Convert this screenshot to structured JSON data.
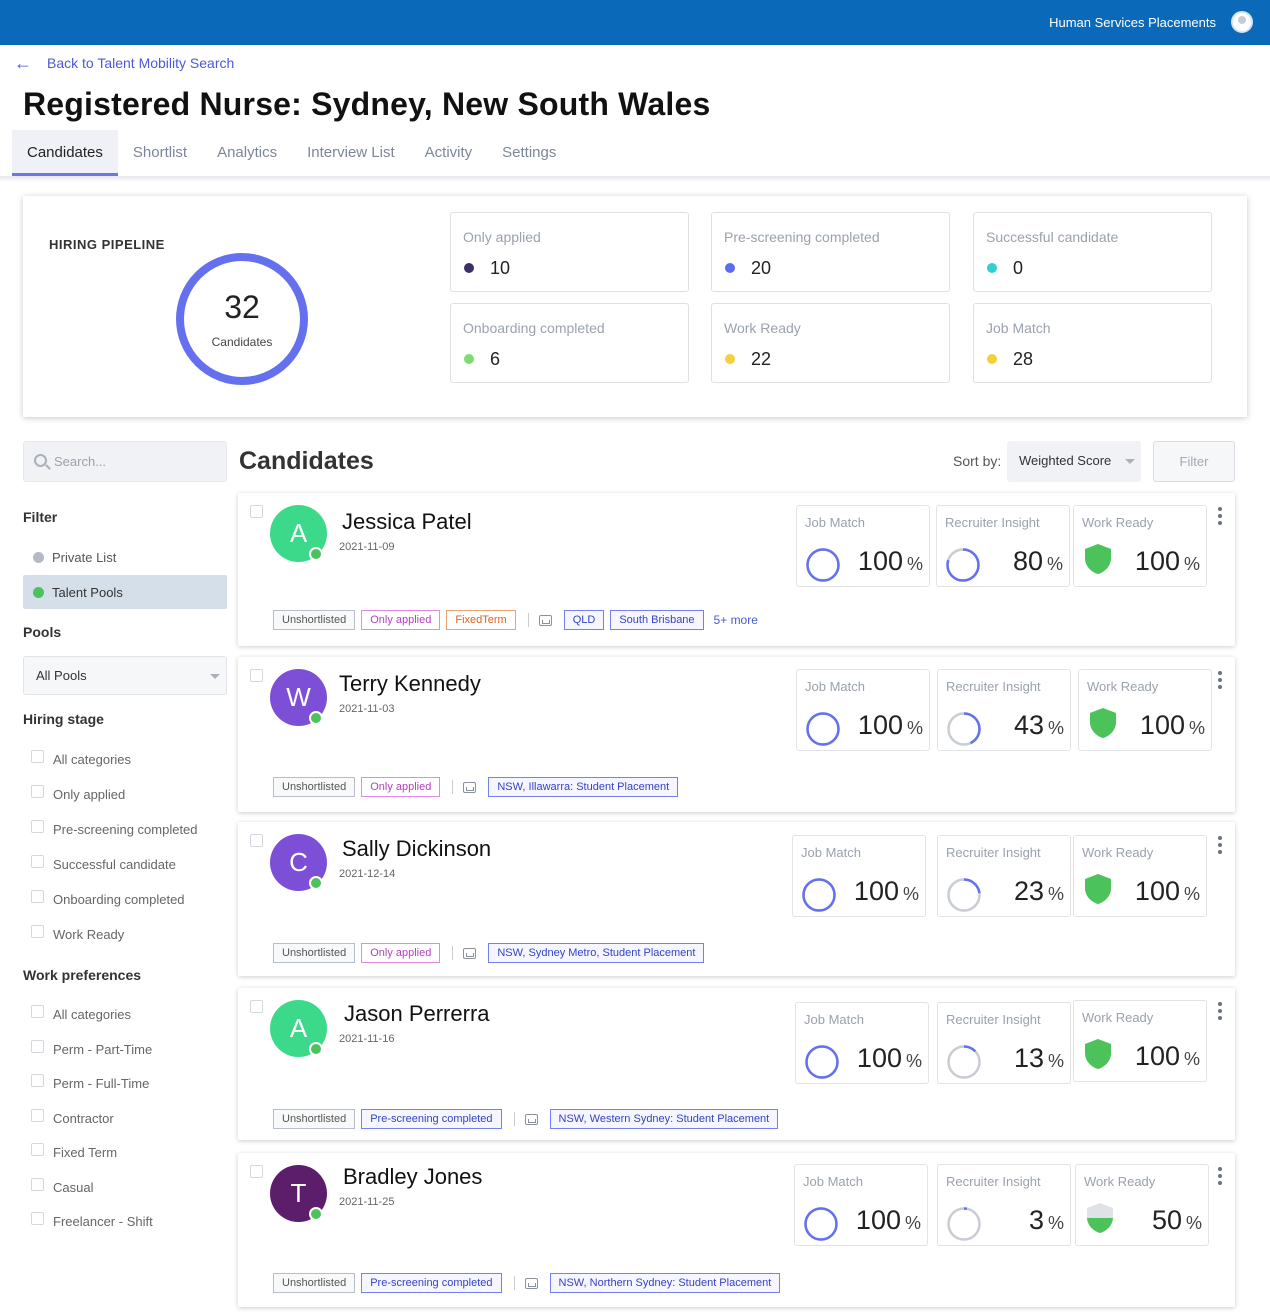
{
  "header": {
    "app_name": "Human Services Placements"
  },
  "back_link": "Back to Talent Mobility Search",
  "page_title": "Registered Nurse: Sydney, New South Wales",
  "tabs": [
    {
      "label": "Candidates",
      "active": true
    },
    {
      "label": "Shortlist"
    },
    {
      "label": "Analytics"
    },
    {
      "label": "Interview List"
    },
    {
      "label": "Activity"
    },
    {
      "label": "Settings"
    }
  ],
  "pipeline": {
    "label": "HIRING PIPELINE",
    "total": "32",
    "total_label": "Candidates",
    "stats": [
      {
        "title": "Only applied",
        "value": "10",
        "color": "#3d2f6b"
      },
      {
        "title": "Pre-screening completed",
        "value": "20",
        "color": "#5a6cf0"
      },
      {
        "title": "Successful candidate",
        "value": "0",
        "color": "#2fd1cf"
      },
      {
        "title": "Onboarding completed",
        "value": "6",
        "color": "#7cdc6e"
      },
      {
        "title": "Work Ready",
        "value": "22",
        "color": "#f2d13c"
      },
      {
        "title": "Job Match",
        "value": "28",
        "color": "#f2d13c"
      }
    ]
  },
  "search": {
    "placeholder": "Search..."
  },
  "sidebar": {
    "filter_heading": "Filter",
    "filter_options": [
      "Private List",
      "Talent Pools"
    ],
    "pools_heading": "Pools",
    "pools_value": "All Pools",
    "hiring_stage_heading": "Hiring stage",
    "hiring_stages": [
      "All categories",
      "Only applied",
      "Pre-screening completed",
      "Successful candidate",
      "Onboarding completed",
      "Work Ready"
    ],
    "work_pref_heading": "Work preferences",
    "work_prefs": [
      "All categories",
      "Perm - Part-Time",
      "Perm - Full-Time",
      "Contractor",
      "Fixed Term",
      "Casual",
      "Freelancer - Shift"
    ]
  },
  "candidates_title": "Candidates",
  "sort": {
    "label": "Sort by:",
    "value": "Weighted Score"
  },
  "filter_button": "Filter",
  "metric_labels": {
    "job_match": "Job Match",
    "recruiter_insight": "Recruiter Insight",
    "work_ready": "Work Ready",
    "pct": "%"
  },
  "colors": {
    "accent": "#6470ee",
    "topbar": "#0a69b8",
    "green": "#4cc35a"
  },
  "candidates": [
    {
      "initial": "A",
      "avatar_color": "#3dd98a",
      "name": "Jessica Patel",
      "date": "2021-11-09",
      "job_match": "100",
      "recruiter_insight": "80",
      "work_ready": "100",
      "tags": [
        "Unshortlisted",
        "Only applied",
        "FixedTerm"
      ],
      "locations": [
        "QLD",
        "South Brisbane"
      ],
      "more": "5+ more"
    },
    {
      "initial": "W",
      "avatar_color": "#7c4fd6",
      "name": "Terry Kennedy",
      "date": "2021-11-03",
      "job_match": "100",
      "recruiter_insight": "43",
      "work_ready": "100",
      "tags": [
        "Unshortlisted",
        "Only applied"
      ],
      "locations": [
        "NSW, Illawarra: Student Placement"
      ]
    },
    {
      "initial": "C",
      "avatar_color": "#7c4fd6",
      "name": "Sally Dickinson",
      "date": "2021-12-14",
      "job_match": "100",
      "recruiter_insight": "23",
      "work_ready": "100",
      "tags": [
        "Unshortlisted",
        "Only applied"
      ],
      "locations": [
        "NSW, Sydney Metro, Student Placement"
      ]
    },
    {
      "initial": "A",
      "avatar_color": "#3dd98a",
      "name": "Jason Perrerra",
      "date": "2021-11-16",
      "job_match": "100",
      "recruiter_insight": "13",
      "work_ready": "100",
      "tags": [
        "Unshortlisted",
        "Pre-screening completed"
      ],
      "locations": [
        "NSW, Western Sydney: Student Placement"
      ]
    },
    {
      "initial": "T",
      "avatar_color": "#5c1d6b",
      "name": "Bradley Jones",
      "date": "2021-11-25",
      "job_match": "100",
      "recruiter_insight": "3",
      "work_ready": "50",
      "tags": [
        "Unshortlisted",
        "Pre-screening completed"
      ],
      "locations": [
        "NSW, Northern Sydney: Student Placement"
      ]
    }
  ]
}
